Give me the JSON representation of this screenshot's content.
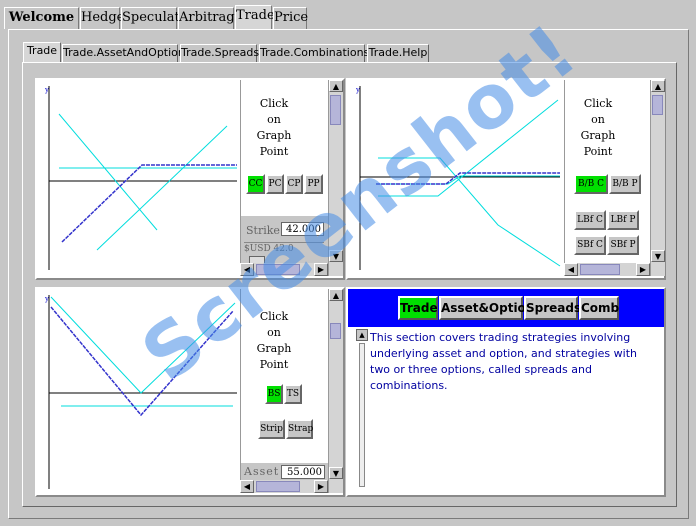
{
  "top_tabs": [
    "Welcome",
    "Hedge",
    "Speculate",
    "Arbitrage",
    "Trade",
    "Price"
  ],
  "sub_tabs": [
    "Trade",
    "Trade.AssetAndOption",
    "Trade.Spreads",
    "Trade.Combinations",
    "Trade.Help"
  ],
  "panel_tl": {
    "click_lines": [
      "Click",
      "on",
      "Graph",
      "Point"
    ],
    "buttons": [
      "CC",
      "PC",
      "CP",
      "PP"
    ],
    "strike_label": "Strike",
    "strike_value": "42.000",
    "slider_label": "$USD 42.0"
  },
  "panel_tr": {
    "click_lines": [
      "Click",
      "on",
      "Graph",
      "Point"
    ],
    "buttons_row1": [
      "B/B C",
      "B/B P"
    ],
    "buttons_row2": [
      "LBf C",
      "LBf P"
    ],
    "buttons_row3": [
      "SBf C",
      "SBf P"
    ]
  },
  "panel_bl": {
    "click_lines": [
      "Click",
      "on",
      "Graph",
      "Point"
    ],
    "buttons_row1": [
      "BS",
      "TS"
    ],
    "buttons_row2": [
      "Strip",
      "Strap"
    ],
    "asset_label": "Asset",
    "asset_value": "55.000"
  },
  "help": {
    "nav": [
      "Trade",
      "Asset&Option",
      "Spreads",
      "Comb"
    ],
    "text": "This section covers trading strategies involving underlying asset and option, and strategies with two or three options, called spreads and combinations."
  },
  "watermark": "Screenshot!",
  "colors": {
    "accent_green": "#00e000",
    "nav_blue": "#0000ff",
    "text_blue": "#0000a0",
    "payoff_line": "#3333cc",
    "cyan_line": "#00dddd"
  }
}
